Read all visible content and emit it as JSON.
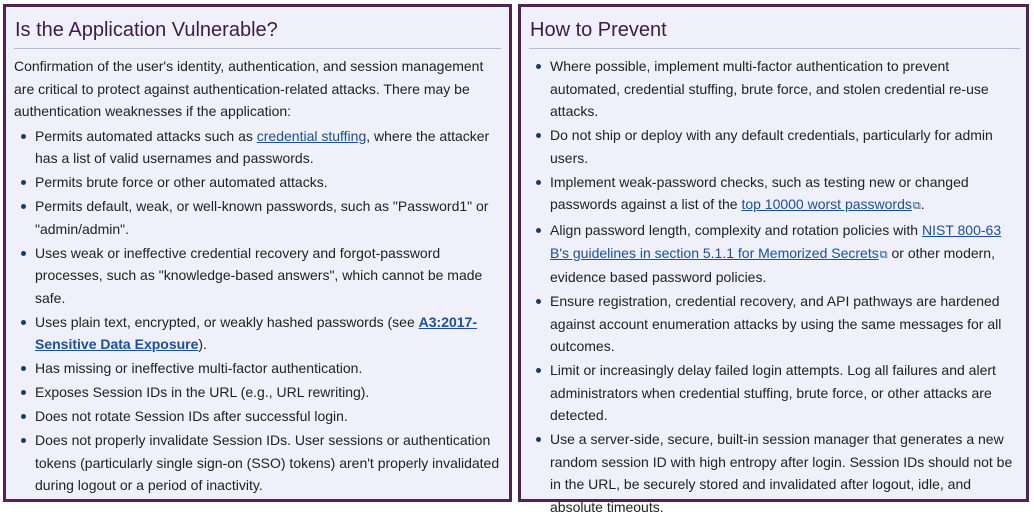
{
  "left": {
    "title": "Is the Application Vulnerable?",
    "intro": "Confirmation of the user's identity, authentication, and session management are critical to protect against authentication-related attacks. There may be authentication weaknesses if the application:",
    "items": [
      {
        "pre": "Permits automated attacks such as ",
        "link": "credential stuffing",
        "post": ", where the attacker has a list of valid usernames and passwords."
      },
      {
        "pre": "Permits brute force or other automated attacks."
      },
      {
        "pre": "Permits default, weak, or well-known passwords, such as \"Password1\" or \"admin/admin\"."
      },
      {
        "pre": "Uses weak or ineffective credential recovery and forgot-password processes, such as \"knowledge-based answers\", which cannot be made safe."
      },
      {
        "pre": "Uses plain text, encrypted, or weakly hashed passwords (see ",
        "link": "A3:2017-Sensitive Data Exposure",
        "post": ")."
      },
      {
        "pre": "Has missing or ineffective multi-factor authentication."
      },
      {
        "pre": "Exposes Session IDs in the URL (e.g., URL rewriting)."
      },
      {
        "pre": "Does not rotate Session IDs after successful login."
      },
      {
        "pre": "Does not properly invalidate Session IDs. User sessions or authentication tokens (particularly single sign-on (SSO) tokens) aren't properly invalidated during logout or a period of inactivity."
      }
    ]
  },
  "right": {
    "title": "How to Prevent",
    "items": [
      {
        "pre": "Where possible, implement multi-factor authentication to prevent automated, credential stuffing, brute force, and stolen credential re-use attacks."
      },
      {
        "pre": "Do not ship or deploy with any default credentials, particularly for admin users."
      },
      {
        "pre": "Implement weak-password checks, such as testing new or changed passwords against a list of the ",
        "link": "top 10000 worst passwords",
        "post": "."
      },
      {
        "pre": "Align password length, complexity and rotation policies with ",
        "link": "NIST 800-63 B's guidelines in section 5.1.1 for Memorized Secrets",
        "post": " or other modern, evidence based password policies."
      },
      {
        "pre": "Ensure registration, credential recovery, and API pathways are hardened against account enumeration attacks by using the same messages for all outcomes."
      },
      {
        "pre": "Limit or increasingly delay failed login attempts. Log all failures and alert administrators when credential stuffing, brute force, or other attacks are detected."
      },
      {
        "pre": "Use a server-side, secure, built-in session manager that generates a new random session ID with high entropy after login. Session IDs should not be in the URL, be securely stored and invalidated after logout, idle, and absolute timeouts."
      }
    ]
  }
}
